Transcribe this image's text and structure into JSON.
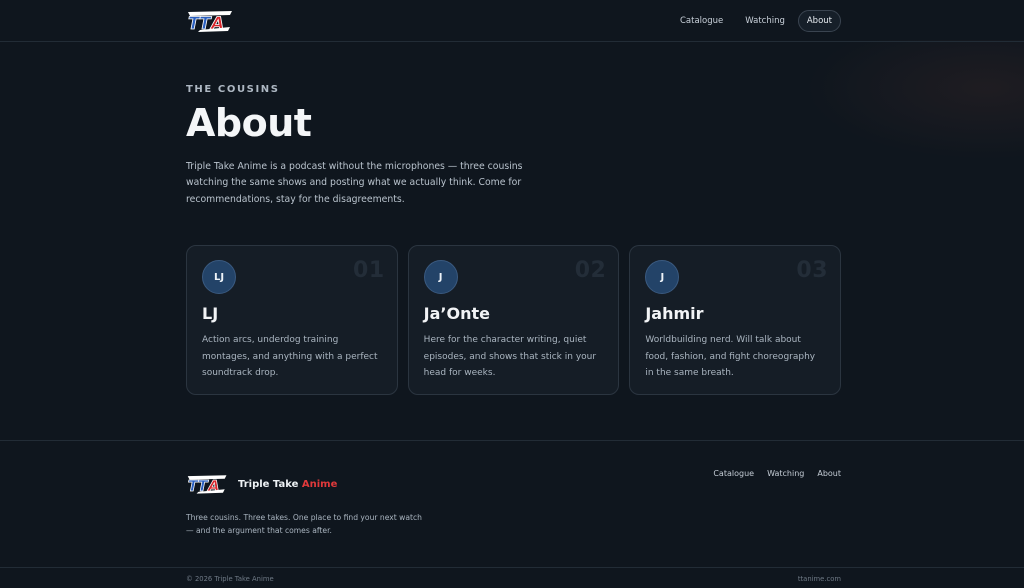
{
  "header": {
    "logo_icon": "tta-logo-icon",
    "nav": [
      {
        "label": "Catalogue",
        "active": false
      },
      {
        "label": "Watching",
        "active": false
      },
      {
        "label": "About",
        "active": true
      }
    ]
  },
  "hero": {
    "eyebrow": "THE COUSINS",
    "title": "About",
    "description": "Triple Take Anime is a podcast without the microphones — three cousins watching the same shows and posting what we actually think. Come for recommendations, stay for the disagreements."
  },
  "cards": [
    {
      "initials": "LJ",
      "number": "01",
      "name": "LJ",
      "description": "Action arcs, underdog training montages, and anything with a perfect soundtrack drop."
    },
    {
      "initials": "J",
      "number": "02",
      "name": "Ja’Onte",
      "description": "Here for the character writing, quiet episodes, and shows that stick in your head for weeks."
    },
    {
      "initials": "J",
      "number": "03",
      "name": "Jahmir",
      "description": "Worldbuilding nerd. Will talk about food, fashion, and fight choreography in the same breath."
    }
  ],
  "footer": {
    "brand_main": "Triple Take",
    "brand_accent": "Anime",
    "tagline": "Three cousins. Three takes. One place to find your next watch — and the argument that comes after.",
    "nav": [
      "Catalogue",
      "Watching",
      "About"
    ],
    "copyright": "© 2026 Triple Take Anime",
    "domain": "ttanime.com"
  },
  "colors": {
    "background": "#0f161e",
    "card": "#151d26",
    "accent_red": "#e0393b",
    "accent_blue": "#234368"
  }
}
